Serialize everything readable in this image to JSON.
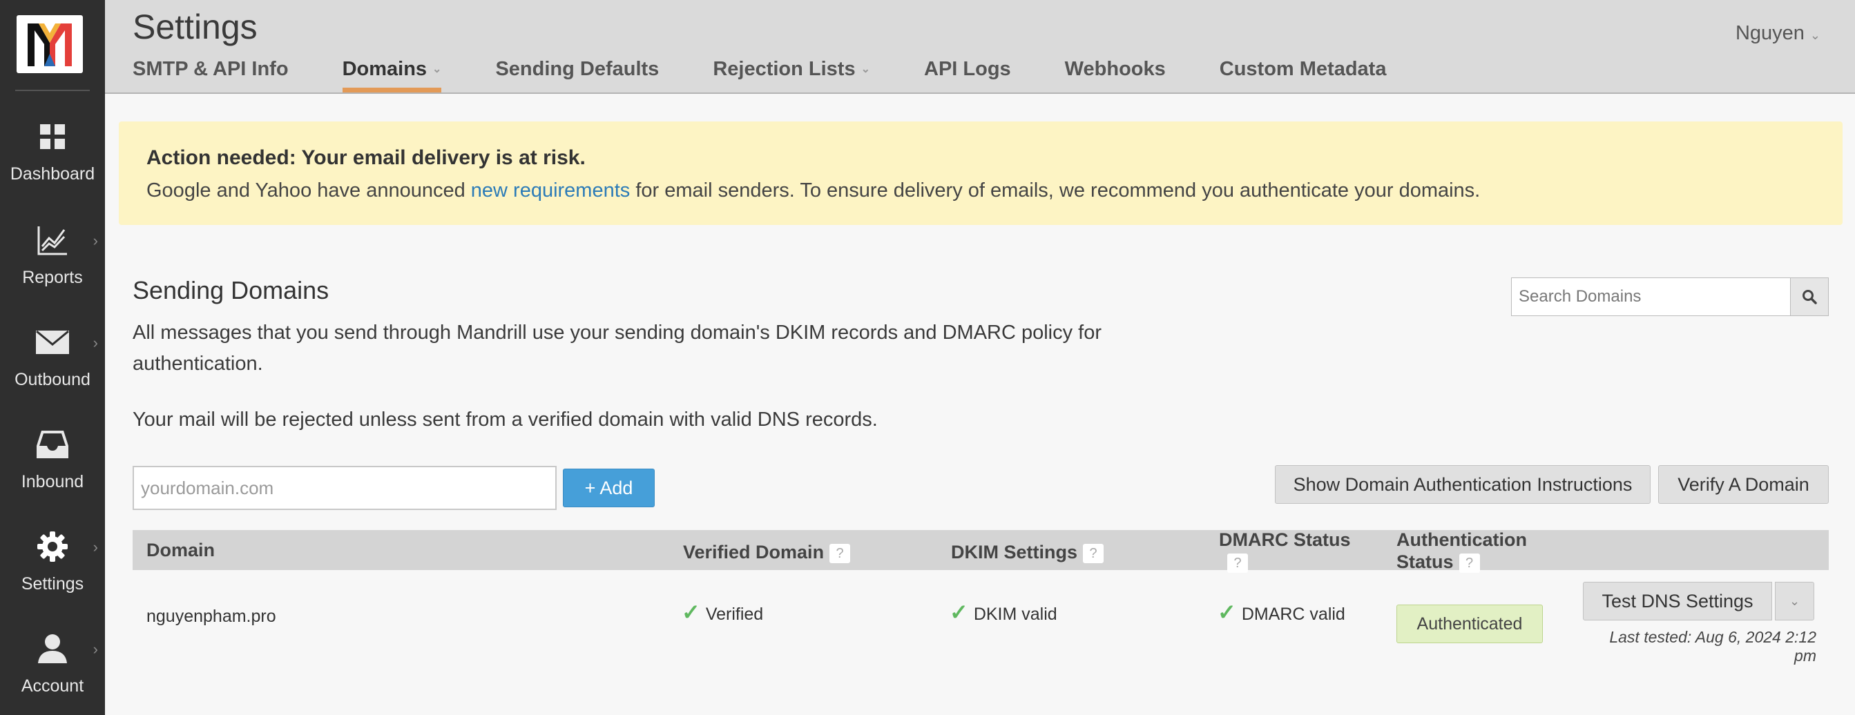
{
  "app": {
    "logo_letter": "M"
  },
  "sidebar": {
    "items": [
      {
        "label": "Dashboard",
        "icon": "grid-icon"
      },
      {
        "label": "Reports",
        "icon": "chart-icon"
      },
      {
        "label": "Outbound",
        "icon": "envelope-icon"
      },
      {
        "label": "Inbound",
        "icon": "inbox-icon"
      },
      {
        "label": "Settings",
        "icon": "gear-icon"
      },
      {
        "label": "Account",
        "icon": "user-icon"
      }
    ]
  },
  "header": {
    "title": "Settings",
    "user": "Nguyen",
    "tabs": [
      {
        "label": "SMTP & API Info"
      },
      {
        "label": "Domains"
      },
      {
        "label": "Sending Defaults"
      },
      {
        "label": "Rejection Lists"
      },
      {
        "label": "API Logs"
      },
      {
        "label": "Webhooks"
      },
      {
        "label": "Custom Metadata"
      }
    ]
  },
  "banner": {
    "title": "Action needed: Your email delivery is at risk.",
    "text_before": "Google and Yahoo have announced ",
    "link": "new requirements",
    "text_after": " for email senders. To ensure delivery of emails, we recommend you authenticate your domains."
  },
  "section": {
    "title": "Sending Domains",
    "description": "All messages that you send through Mandrill use your sending domain's DKIM records and DMARC policy for authentication.",
    "note": "Your mail will be rejected unless sent from a verified domain with valid DNS records."
  },
  "search": {
    "placeholder": "Search Domains"
  },
  "add_form": {
    "placeholder": "yourdomain.com",
    "add_label": "+ Add"
  },
  "actions": {
    "instructions_label": "Show Domain Authentication Instructions",
    "verify_label": "Verify A Domain"
  },
  "table": {
    "headers": {
      "domain": "Domain",
      "verified": "Verified Domain",
      "dkim": "DKIM Settings",
      "dmarc": "DMARC Status",
      "auth_line1": "Authentication",
      "auth_line2": "Status",
      "help": "?"
    },
    "row": {
      "domain": "nguyenpham.pro",
      "verified": "Verified",
      "dkim": "DKIM valid",
      "dmarc": "DMARC valid",
      "auth_status": "Authenticated",
      "test_label": "Test DNS Settings",
      "last_tested": "Last tested: Aug 6, 2024 2:12 pm"
    }
  },
  "colors": {
    "sidebar_bg": "#2f2f2f",
    "header_bg": "#dadada",
    "active_tab": "#e39a57",
    "banner_bg": "#fdf4c4",
    "link": "#2c7bb7",
    "primary_button": "#469fd9",
    "check": "#5fb85f",
    "badge_bg": "#e2f0c4"
  }
}
